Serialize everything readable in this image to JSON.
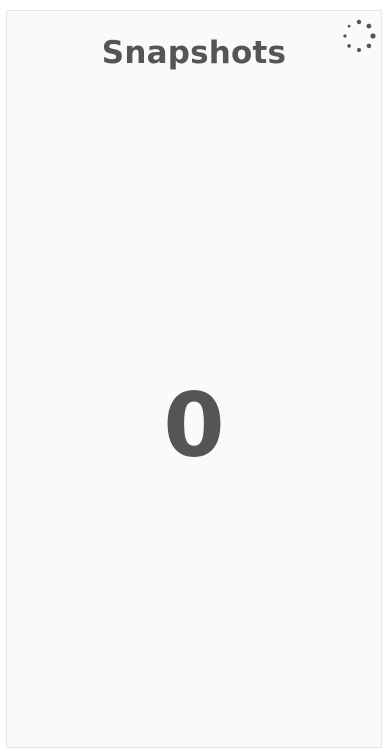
{
  "widget": {
    "title": "Snapshots",
    "count": "0",
    "status_icon": "loading-spinner-icon"
  },
  "colors": {
    "background": "#fafafa",
    "text": "#555555",
    "border": "#e6e6e6"
  }
}
